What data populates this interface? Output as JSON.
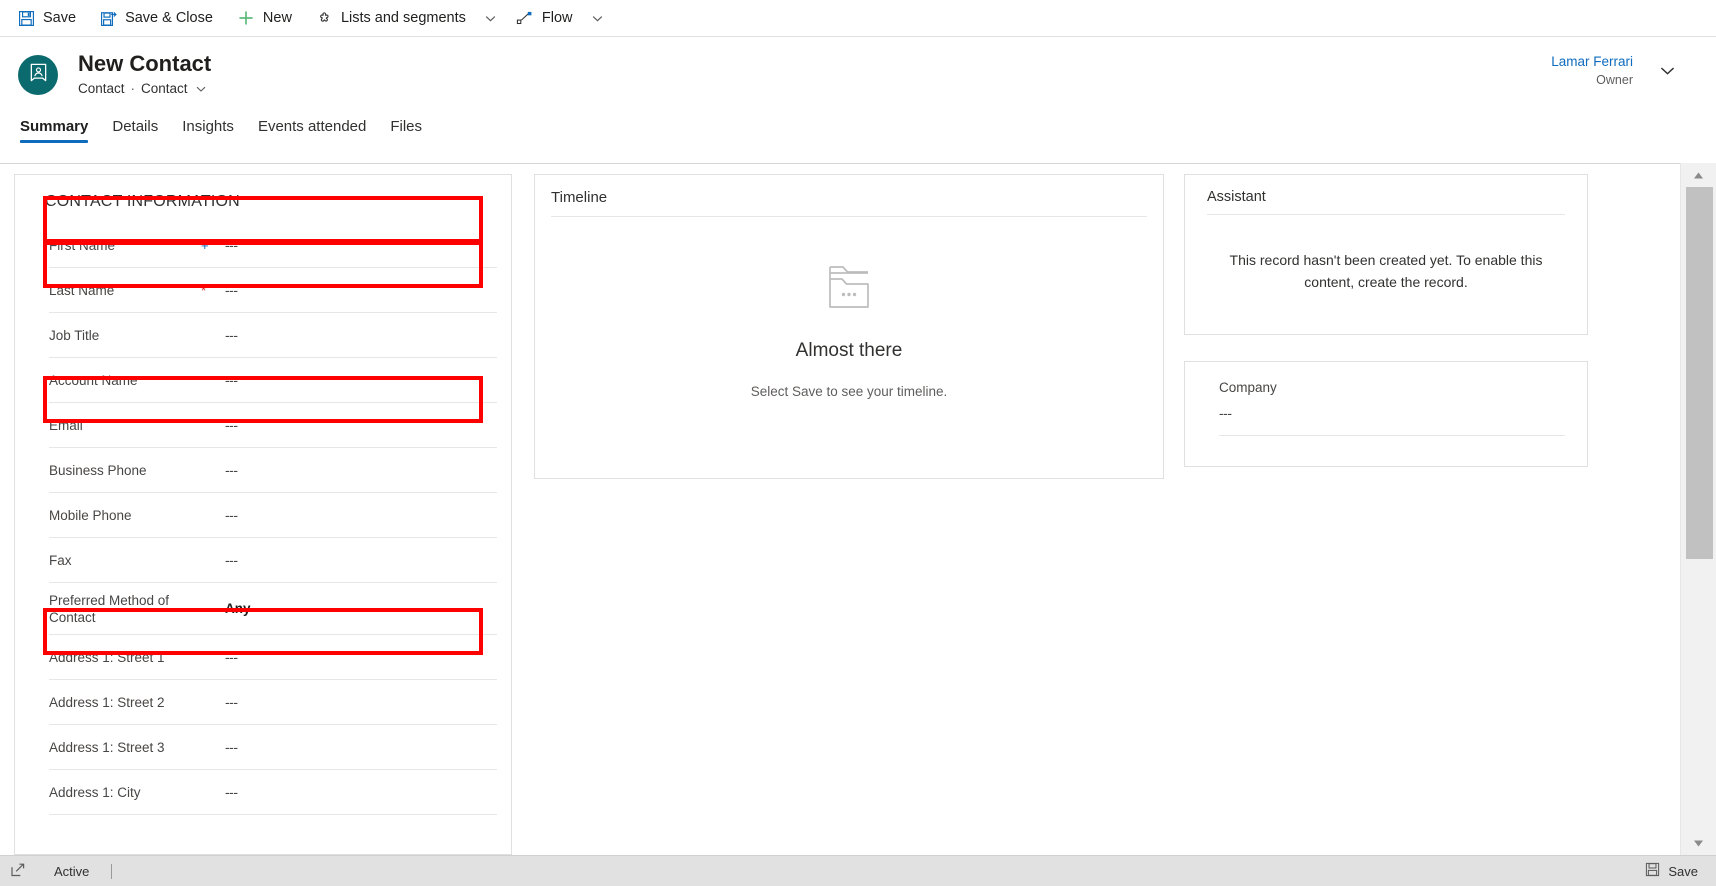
{
  "commandbar": {
    "items": [
      {
        "label": "Save",
        "icon": "save-icon",
        "caret": false
      },
      {
        "label": "Save & Close",
        "icon": "save-close-icon",
        "caret": false
      },
      {
        "label": "New",
        "icon": "plus-icon",
        "caret": false
      },
      {
        "label": "Lists and segments",
        "icon": "puzzle-icon",
        "caret": true
      },
      {
        "label": "Flow",
        "icon": "flow-icon",
        "caret": true
      }
    ]
  },
  "record_header": {
    "title": "New Contact",
    "subtitle_entity": "Contact",
    "subtitle_separator": "·",
    "subtitle_form": "Contact",
    "avatar_icon": "contact-badge-icon",
    "owner_name": "Lamar Ferrari",
    "owner_role": "Owner"
  },
  "tabs": [
    {
      "label": "Summary",
      "active": true
    },
    {
      "label": "Details",
      "active": false
    },
    {
      "label": "Insights",
      "active": false
    },
    {
      "label": "Events attended",
      "active": false
    },
    {
      "label": "Files",
      "active": false
    }
  ],
  "contact_information": {
    "section_title": "CONTACT INFORMATION",
    "fields": [
      {
        "label": "First Name",
        "value": "---",
        "required": "recommended",
        "highlighted": true,
        "filled": false
      },
      {
        "label": "Last Name",
        "value": "---",
        "required": "required",
        "highlighted": true,
        "filled": false
      },
      {
        "label": "Job Title",
        "value": "---",
        "required": "none",
        "highlighted": false,
        "filled": false
      },
      {
        "label": "Account Name",
        "value": "---",
        "required": "none",
        "highlighted": false,
        "filled": false
      },
      {
        "label": "Email",
        "value": "---",
        "required": "none",
        "highlighted": true,
        "filled": false
      },
      {
        "label": "Business Phone",
        "value": "---",
        "required": "none",
        "highlighted": false,
        "filled": false
      },
      {
        "label": "Mobile Phone",
        "value": "---",
        "required": "none",
        "highlighted": false,
        "filled": false
      },
      {
        "label": "Fax",
        "value": "---",
        "required": "none",
        "highlighted": false,
        "filled": false
      },
      {
        "label": "Preferred Method of Contact",
        "value": "Any",
        "required": "none",
        "highlighted": false,
        "filled": true
      },
      {
        "label": "Address 1: Street 1",
        "value": "---",
        "required": "none",
        "highlighted": true,
        "filled": false
      },
      {
        "label": "Address 1: Street 2",
        "value": "---",
        "required": "none",
        "highlighted": false,
        "filled": false
      },
      {
        "label": "Address 1: Street 3",
        "value": "---",
        "required": "none",
        "highlighted": false,
        "filled": false
      },
      {
        "label": "Address 1: City",
        "value": "---",
        "required": "none",
        "highlighted": false,
        "filled": false
      }
    ],
    "required_marker_required": "*",
    "required_marker_recommended": "+"
  },
  "timeline": {
    "title": "Timeline",
    "empty_icon": "file-stack-icon",
    "empty_title": "Almost there",
    "empty_subtitle": "Select Save to see your timeline."
  },
  "assistant": {
    "title": "Assistant",
    "message": "This record hasn't been created yet. To enable this content, create the record."
  },
  "company_card": {
    "label": "Company",
    "value": "---"
  },
  "footer": {
    "expand_icon": "open-in-new-window-icon",
    "status": "Active",
    "save_label": "Save",
    "save_icon": "save-icon"
  },
  "colors": {
    "accent_blue": "#0f6cbd",
    "avatar_teal": "#0b6a6e",
    "highlight_red": "#ff0000",
    "required_red": "#d13438",
    "new_green": "#5cbb79"
  }
}
